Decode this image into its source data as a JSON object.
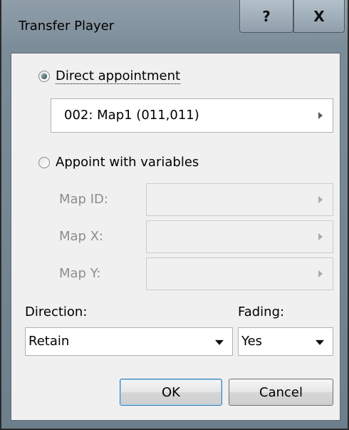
{
  "window": {
    "title": "Transfer Player",
    "help_glyph": "?",
    "close_glyph": "X"
  },
  "direct": {
    "label": "Direct appointment",
    "selected": true,
    "map_value": "002: Map1 (011,011)"
  },
  "variables": {
    "label": "Appoint with variables",
    "selected": false,
    "map_id_label": "Map ID:",
    "map_x_label": "Map X:",
    "map_y_label": "Map Y:",
    "map_id_value": "",
    "map_x_value": "",
    "map_y_value": ""
  },
  "direction": {
    "label": "Direction:",
    "value": "Retain"
  },
  "fading": {
    "label": "Fading:",
    "value": "Yes"
  },
  "buttons": {
    "ok": "OK",
    "cancel": "Cancel"
  },
  "icons": {
    "help": "help-icon",
    "close": "close-icon",
    "arrow": "arrow-right-icon",
    "dropdown": "chevron-down-icon"
  }
}
